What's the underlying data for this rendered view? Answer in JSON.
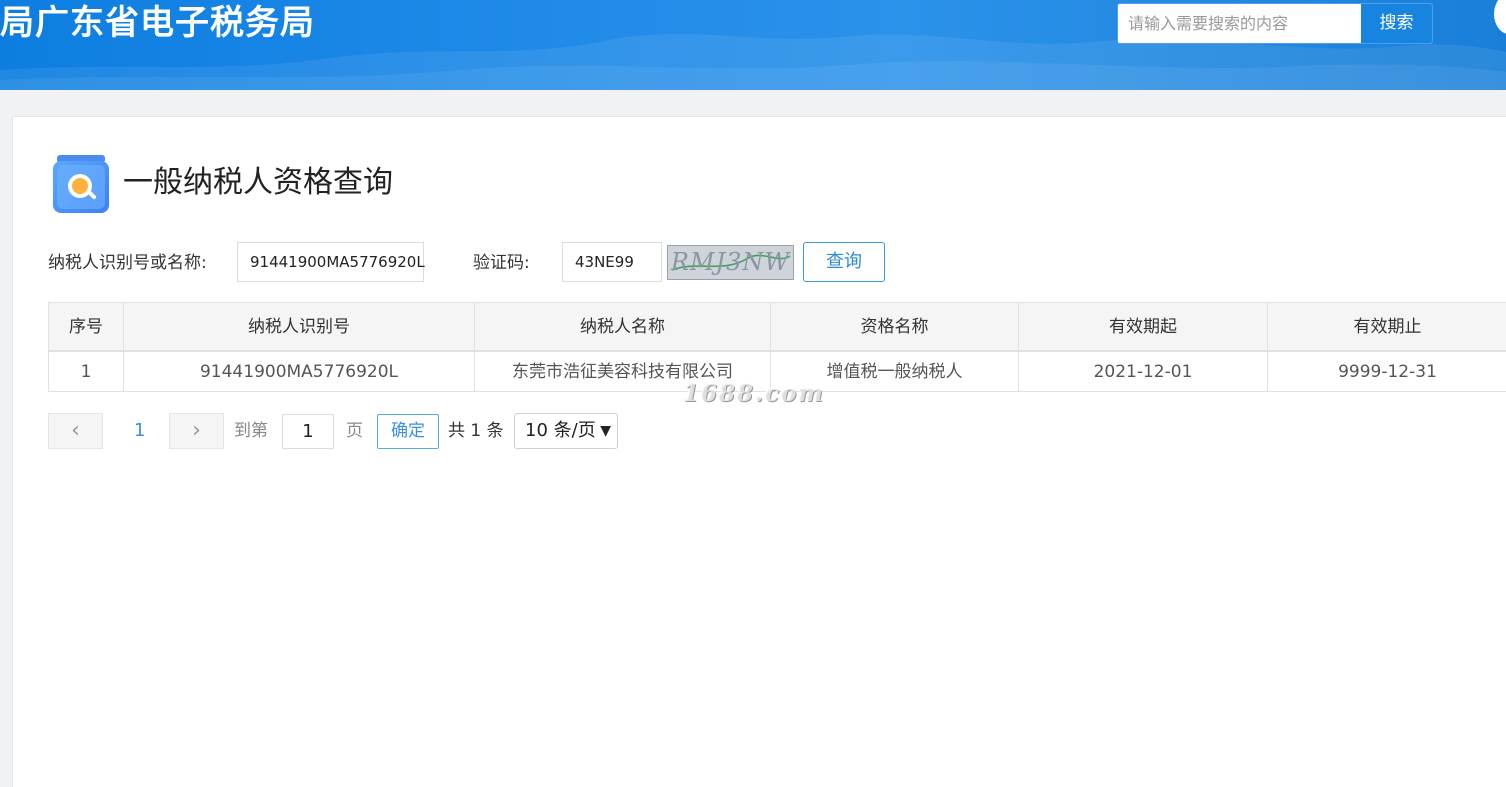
{
  "header": {
    "site_title": "局广东省电子税务局",
    "search_placeholder": "请输入需要搜索的内容",
    "search_button": "搜索"
  },
  "page": {
    "title": "一般纳税人资格查询",
    "icon": "search-document-icon"
  },
  "form": {
    "taxpayer_label": "纳税人识别号或名称:",
    "taxpayer_value": "91441900MA5776920L",
    "captcha_label": "验证码:",
    "captcha_value": "43NE99",
    "captcha_image_text": "RMJ3NW",
    "query_button": "查询"
  },
  "table": {
    "headers": [
      "序号",
      "纳税人识别号",
      "纳税人名称",
      "资格名称",
      "有效期起",
      "有效期止"
    ],
    "rows": [
      [
        "1",
        "91441900MA5776920L",
        "东莞市浩征美容科技有限公司",
        "增值税一般纳税人",
        "2021-12-01",
        "9999-12-31"
      ]
    ]
  },
  "pagination": {
    "prev": "‹",
    "current_page": "1",
    "next": "›",
    "goto_label": "到第",
    "goto_value": "1",
    "page_suffix": "页",
    "confirm": "确定",
    "total": "共 1 条",
    "page_size": "10 条/页"
  },
  "watermark": "1688.com",
  "colors": {
    "header_blue": "#1784e0",
    "accent": "#3a8ee6"
  }
}
